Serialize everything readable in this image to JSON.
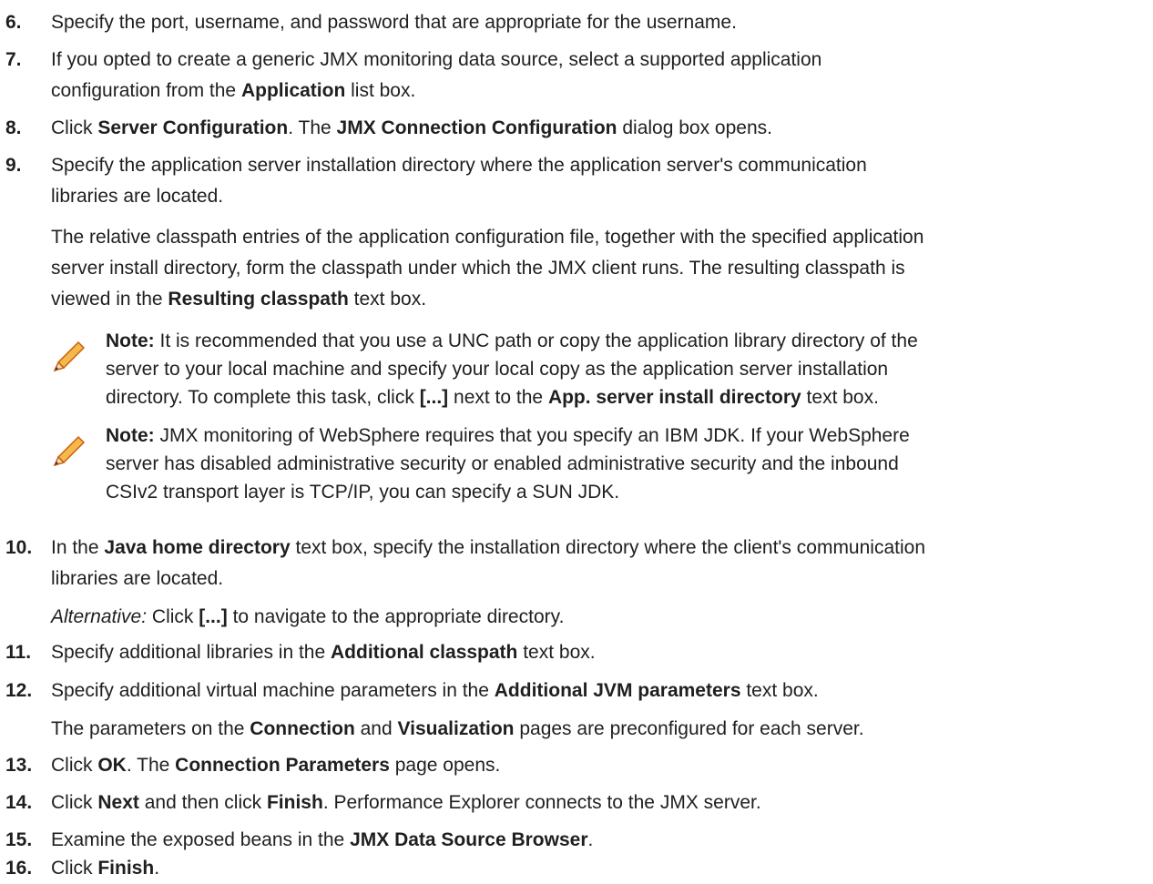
{
  "steps": {
    "s6": {
      "num": "6.",
      "text": "Specify the port, username, and password that are appropriate for the username."
    },
    "s7": {
      "num": "7.",
      "l1_pre": "If you opted to create a generic JMX monitoring data source, select a supported application",
      "l2_pre": "configuration from the ",
      "l2_bold": "Application",
      "l2_post": " list box."
    },
    "s8": {
      "num": "8.",
      "pre": "Click ",
      "b1": "Server Configuration",
      "mid": ". The ",
      "b2": "JMX Connection Configuration",
      "post": " dialog box opens."
    },
    "s9": {
      "num": "9.",
      "l1": "Specify the application server installation directory where the application server's communication",
      "l2": "libraries are located.",
      "para_l1": "The relative classpath entries of the application configuration file, together with the specified application",
      "para_l2": "server install directory, form the classpath under which the JMX client runs. The resulting classpath is",
      "para_l3_pre": "viewed in the ",
      "para_l3_bold": "Resulting classpath",
      "para_l3_post": " text box."
    },
    "note1": {
      "label": "Note:",
      "l1_post": " It is recommended that you use a UNC path or copy the application library directory of the",
      "l2": "server to your local machine and specify your local copy as the application server installation",
      "l3_pre": "directory. To complete this task, click ",
      "l3_b1": "[...]",
      "l3_mid": " next to the ",
      "l3_b2": "App. server install directory",
      "l3_post": " text box."
    },
    "note2": {
      "label": "Note:",
      "l1_post": " JMX monitoring of WebSphere requires that you specify an IBM JDK. If your WebSphere",
      "l2": "server has disabled administrative security or enabled administrative security and the inbound",
      "l3": "CSIv2 transport layer is TCP/IP, you can specify a SUN JDK."
    },
    "s10": {
      "num": "10.",
      "pre": "In the ",
      "bold": "Java home directory",
      "post": " text box, specify the installation directory where the client's communication",
      "l2": "libraries are located.",
      "alt_label": "Alternative:",
      "alt_pre": " Click ",
      "alt_bold": "[...]",
      "alt_post": " to navigate to the appropriate directory."
    },
    "s11": {
      "num": "11.",
      "pre": "Specify additional libraries in the ",
      "bold": "Additional classpath",
      "post": " text box."
    },
    "s12": {
      "num": "12.",
      "pre": "Specify additional virtual machine parameters in the ",
      "bold": "Additional JVM parameters",
      "post": " text box.",
      "p_pre": "The parameters on the ",
      "p_b1": "Connection",
      "p_mid": " and ",
      "p_b2": "Visualization",
      "p_post": " pages are preconfigured for each server."
    },
    "s13": {
      "num": "13.",
      "pre": "Click ",
      "b1": "OK",
      "mid": ". The ",
      "b2": "Connection Parameters",
      "post": " page opens."
    },
    "s14": {
      "num": "14.",
      "pre": "Click ",
      "b1": "Next",
      "mid": " and then click ",
      "b2": "Finish",
      "post": ". Performance Explorer connects to the JMX server."
    },
    "s15": {
      "num": "15.",
      "pre": "Examine the exposed beans in the ",
      "bold": "JMX Data Source Browser",
      "post": "."
    },
    "s16": {
      "num": "16.",
      "pre": "Click ",
      "bold": "Finish",
      "post": "."
    }
  },
  "colors": {
    "pencil_body": "#f0a030",
    "pencil_edge": "#c86010",
    "text": "#1f1f1f"
  },
  "icons": [
    "pencil-note-icon"
  ]
}
